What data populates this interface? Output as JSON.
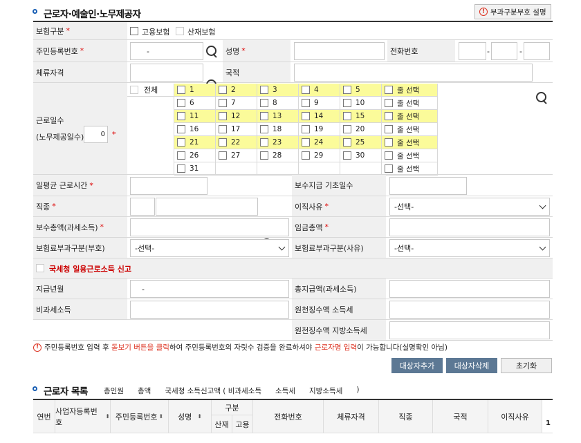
{
  "section1": {
    "title": "근로자·예술인·노무제공자",
    "help_button": "부과구분부호 설명"
  },
  "fields": {
    "insurance_type": {
      "label": "보험구분",
      "options": [
        "고용보험",
        "산재보험"
      ]
    },
    "resident_no": {
      "label": "주민등록번호",
      "value": "-"
    },
    "name": {
      "label": "성명"
    },
    "phone": {
      "label": "전화번호",
      "sep1": "-",
      "sep2": "-"
    },
    "visa": {
      "label": "체류자격"
    },
    "nationality": {
      "label": "국적"
    },
    "workdays": {
      "label_line1": "근로일수",
      "label_line2": "(노무제공일수)",
      "value": "0",
      "all_label": "전체",
      "row_select": "줄 선택",
      "days": [
        "1",
        "2",
        "3",
        "4",
        "5",
        "6",
        "7",
        "8",
        "9",
        "10",
        "11",
        "12",
        "13",
        "14",
        "15",
        "16",
        "17",
        "18",
        "19",
        "20",
        "21",
        "22",
        "23",
        "24",
        "25",
        "26",
        "27",
        "28",
        "29",
        "30",
        "31"
      ]
    },
    "avg_hours": {
      "label": "일평균 근로시간"
    },
    "pay_base_days": {
      "label": "보수지급 기초일수"
    },
    "job_type": {
      "label": "직종"
    },
    "leave_reason": {
      "label": "이직사유",
      "selected": "-선택-"
    },
    "total_pay_taxable": {
      "label": "보수총액(과세소득)"
    },
    "total_wage": {
      "label": "임금총액"
    },
    "premium_code_levy": {
      "label": "보험료부과구분(부호)",
      "selected": "-선택-"
    },
    "premium_code_reason": {
      "label": "보험료부과구분(사유)",
      "selected": "-선택-"
    },
    "nts_daily_income": {
      "label": "국세청 일용근로소득 신고"
    },
    "pay_month": {
      "label": "지급년월",
      "value": "-"
    },
    "total_pay_taxable2": {
      "label": "총지급액(과세소득)"
    },
    "nontaxable": {
      "label": "비과세소득"
    },
    "withholding_income_tax": {
      "label": "원천징수액 소득세"
    },
    "withholding_local_tax": {
      "label": "원천징수액 지방소득세"
    }
  },
  "notice": {
    "part1": "주민등록번호 입력 후 ",
    "part2": "돋보기 버튼을 클릭",
    "part3": "하여 주민등록번호의 자릿수 검증을 완료하셔야 ",
    "part4": "근로자명 입력",
    "part5": "이 가능합니다(실명확인 아님)"
  },
  "actions": {
    "add": "대상자추가",
    "delete": "대상자삭제",
    "reset": "초기화"
  },
  "section2": {
    "title": "근로자 목록",
    "summary": [
      "총인원",
      "총액",
      "국세청 소득신고액 ( 비과세소득",
      "소득세",
      "지방소득세",
      ")"
    ],
    "columns": [
      "연번",
      "사업자등록번호",
      "주민등록번호",
      "성명",
      "구분",
      "산재",
      "고용",
      "전화번호",
      "체류자격",
      "직종",
      "국적",
      "이직사유"
    ],
    "row_num": "1"
  },
  "colors": {
    "accent": "#1a5fb4",
    "highlight": "#fbfb9a",
    "required": "#d00",
    "button_blue": "#5c7894"
  }
}
